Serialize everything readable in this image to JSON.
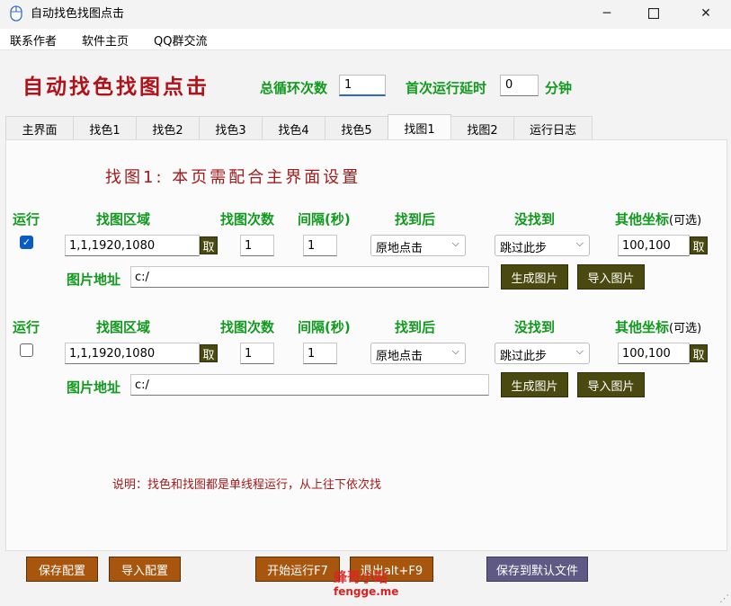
{
  "window": {
    "title": "自动找色找图点击",
    "minimize_icon": "minimize-icon",
    "maximize_icon": "maximize-icon",
    "close_icon": "close-icon"
  },
  "menu": [
    "联系作者",
    "软件主页",
    "QQ群交流"
  ],
  "header": {
    "big_title": "自动找色找图点击",
    "loop_label": "总循环次数",
    "loop_value": "1",
    "delay_label": "首次运行延时",
    "delay_value": "0",
    "delay_unit": "分钟"
  },
  "tabs": [
    "主界面",
    "找色1",
    "找色2",
    "找色3",
    "找色4",
    "找色5",
    "找图1",
    "找图2",
    "运行日志"
  ],
  "active_tab": "找图1",
  "panel": {
    "title": "找图1: 本页需配合主界面设置",
    "headers": {
      "run": "运行",
      "region": "找图区域",
      "count": "找图次数",
      "interval": "间隔(秒)",
      "after_found": "找到后",
      "not_found": "没找到",
      "other_coord": "其他坐标",
      "optional": "(可选)"
    },
    "rows": [
      {
        "checked": true,
        "region": "1,1,1920,1080",
        "pick_label": "取",
        "count": "1",
        "interval": "1",
        "after_found": "原地点击",
        "not_found": "跳过此步",
        "other_coord": "100,100",
        "pick2_label": "取",
        "img_label": "图片地址",
        "img_path": "c:/",
        "gen_btn": "生成图片",
        "import_btn": "导入图片"
      },
      {
        "checked": false,
        "region": "1,1,1920,1080",
        "pick_label": "取",
        "count": "1",
        "interval": "1",
        "after_found": "原地点击",
        "not_found": "跳过此步",
        "other_coord": "100,100",
        "pick2_label": "取",
        "img_label": "图片地址",
        "img_path": "c:/",
        "gen_btn": "生成图片",
        "import_btn": "导入图片"
      }
    ],
    "note": "说明：找色和找图都是单线程运行，从上往下依次找"
  },
  "bottom": {
    "save_config": "保存配置",
    "import_config": "导入配置",
    "start": "开始运行F7",
    "exit": "退出alt+F9",
    "save_default": "保存到默认文件"
  },
  "watermark": {
    "line1": "蜂哥小站",
    "line2": "fengge.me"
  }
}
